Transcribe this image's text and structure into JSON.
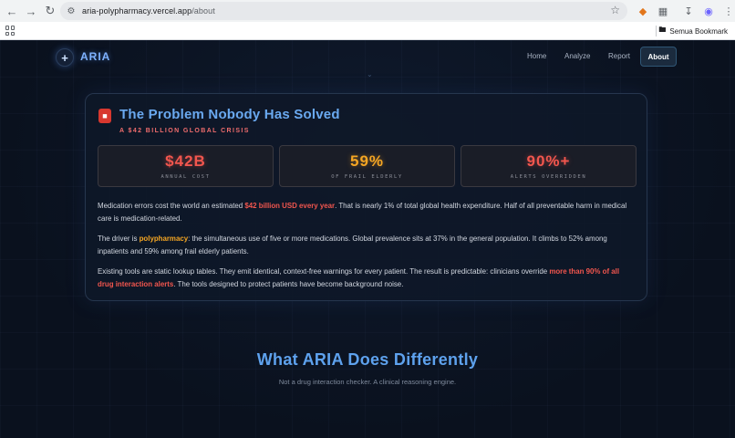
{
  "browser": {
    "url_host": "aria-polypharmacy.vercel.app",
    "url_path": "/about",
    "bookmarks_label": "Semua Bookmark"
  },
  "nav": {
    "logo": "ARIA",
    "links": [
      "Home",
      "Analyze",
      "Report",
      "About"
    ]
  },
  "problem": {
    "title": "The Problem Nobody Has Solved",
    "subtitle": "A $42 BILLION GLOBAL CRISIS",
    "stats": [
      {
        "value": "$42B",
        "label": "ANNUAL COST",
        "color": "#f2564e"
      },
      {
        "value": "59%",
        "label": "OF FRAIL ELDERLY",
        "color": "#f5a623"
      },
      {
        "value": "90%+",
        "label": "ALERTS OVERRIDDEN",
        "color": "#f2564e"
      }
    ],
    "p1_a": "Medication errors cost the world an estimated ",
    "p1_hl": "$42 billion USD every year",
    "p1_b": ". That is nearly 1% of total global health expenditure. Half of all preventable harm in medical care is medication-related.",
    "p2_a": "The driver is ",
    "p2_hl": "polypharmacy",
    "p2_b": ": the simultaneous use of five or more medications. Global prevalence sits at 37% in the general population. It climbs to 52% among inpatients and 59% among frail elderly patients.",
    "p3_a": "Existing tools are static lookup tables. They emit identical, context-free warnings for every patient. The result is predictable: clinicians override ",
    "p3_hl": "more than 90% of all drug interaction alerts",
    "p3_b": ". The tools designed to protect patients have become background noise."
  },
  "section2": {
    "title": "What ARIA Does Differently",
    "subtitle": "Not a drug interaction checker. A clinical reasoning engine."
  },
  "icons": [
    "back-icon",
    "forward-icon",
    "reload-icon",
    "site-settings-icon",
    "star-icon",
    "metamask-icon",
    "extensions-icon",
    "download-icon",
    "profile-icon",
    "menu-icon",
    "apps-icon",
    "folder-icon",
    "pill-icon"
  ]
}
